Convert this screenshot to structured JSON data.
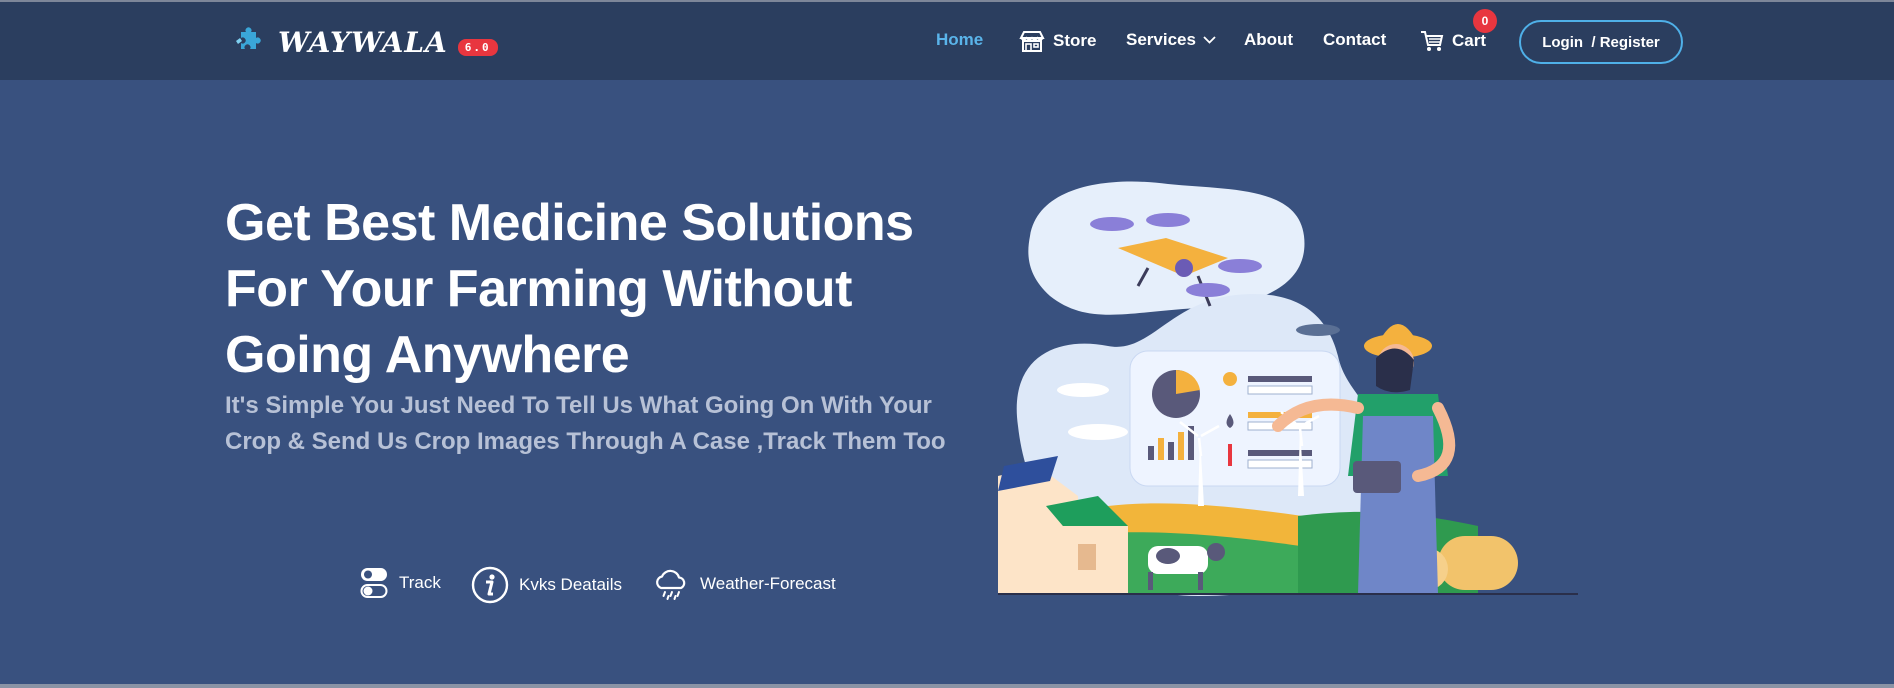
{
  "brand": {
    "name": "WAYWALA",
    "version": "6.0",
    "logo_icon": "puzzle-icon"
  },
  "nav": {
    "home": "Home",
    "store": "Store",
    "services": "Services",
    "about": "About",
    "contact": "Contact",
    "cart": "Cart",
    "cart_count": "0",
    "login": "Login  / Register"
  },
  "hero": {
    "title": "Get Best Medicine Solutions For Your Farming Without Going Anywhere",
    "subtitle": "It's Simple You Just Need To Tell Us What Going On With Your Crop & Send Us Crop Images Through A Case ,Track Them Too"
  },
  "features": [
    {
      "label": "Track",
      "icon": "toggle-track-icon"
    },
    {
      "label": "Kvks Deatails",
      "icon": "info-icon"
    },
    {
      "label": "Weather-Forecast",
      "icon": "cloud-rain-icon"
    }
  ],
  "colors": {
    "background": "#39517f",
    "navbar": "#2b3e5f",
    "accent": "#5ab4ea",
    "badge": "#e8363f"
  }
}
